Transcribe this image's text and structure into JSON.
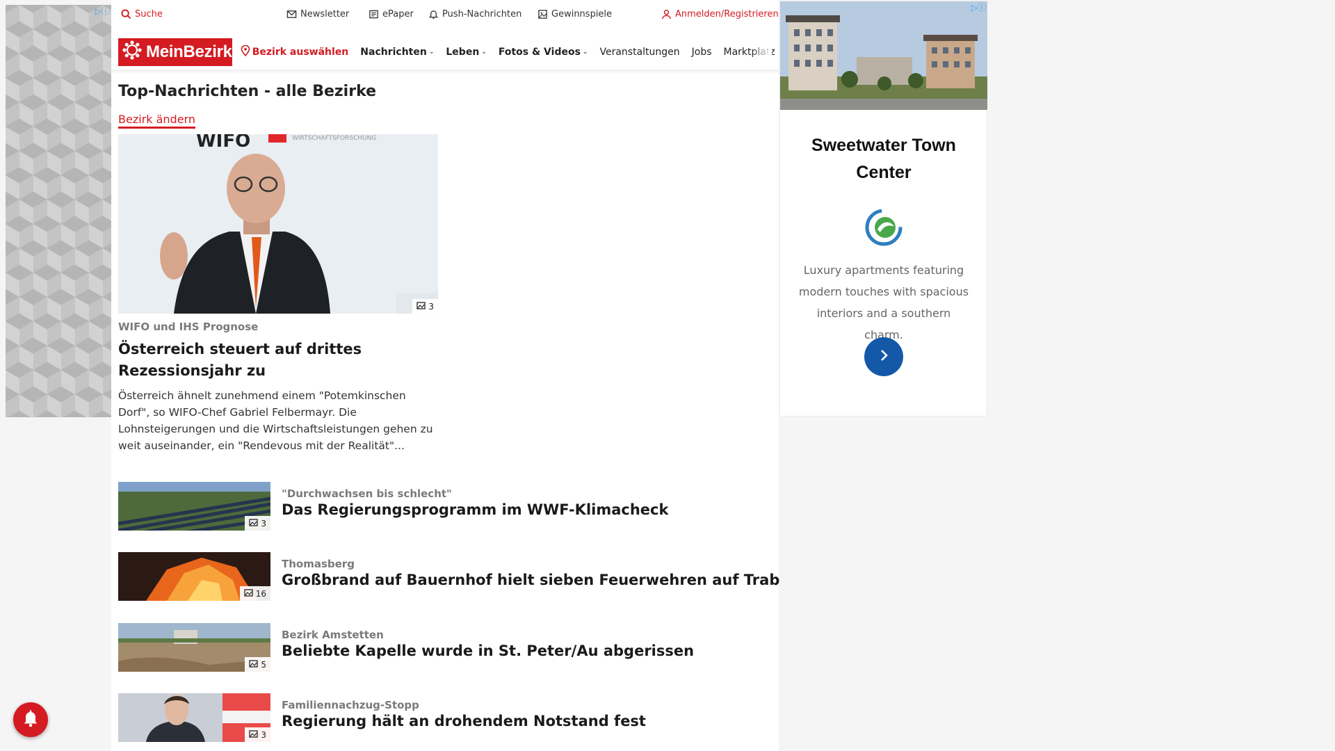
{
  "topbar": {
    "search": "Suche",
    "newsletter": "Newsletter",
    "epaper": "ePaper",
    "push": "Push-Nachrichten",
    "contests": "Gewinnspiele",
    "login": "Anmelden/Registrieren"
  },
  "nav": {
    "logo": "MeinBezirk",
    "district": "Bezirk auswählen",
    "items": [
      "Nachrichten",
      "Leben",
      "Fotos & Videos",
      "Veranstaltungen",
      "Jobs",
      "Marktplatz"
    ]
  },
  "page": {
    "title": "Top-Nachrichten - alle Bezirke",
    "change_link": "Bezirk ändern"
  },
  "lead": {
    "photo_count": "3",
    "kicker": "WIFO und IHS Prognose",
    "title": "Österreich steuert auf drittes Rezessionsjahr zu",
    "teaser": "Österreich ähnelt zunehmend einem \"Potemkinschen Dorf\", so WIFO-Chef Gabriel Felbermayr. Die Lohnsteigerungen und die Wirtschaftsleistungen gehen zu weit auseinander, ein \"Rendevous mit der Realität\"...",
    "image_text": "WIFO WIRTSCHAFTSFORSCHUNG"
  },
  "articles": [
    {
      "kicker": "\"Durchwachsen bis schlecht\"",
      "title": "Das Regierungsprogramm im WWF-Klimacheck",
      "photo_count": "3"
    },
    {
      "kicker": "Thomasberg",
      "title": "Großbrand auf Bauernhof hielt sieben Feuerwehren auf Trab",
      "photo_count": "16"
    },
    {
      "kicker": "Bezirk Amstetten",
      "title": "Beliebte Kapelle wurde in St. Peter/Au abgerissen",
      "photo_count": "5"
    },
    {
      "kicker": "Familiennachzug-Stopp",
      "title": "Regierung hält an drohendem Notstand fest",
      "photo_count": "3"
    }
  ],
  "ad": {
    "title": "Sweetwater Town Center",
    "text": "Luxury apartments featuring modern touches with spacious interiors and a southern charm."
  },
  "colors": {
    "brand_red": "#d41b22",
    "ad_cta_blue": "#1458a8"
  }
}
